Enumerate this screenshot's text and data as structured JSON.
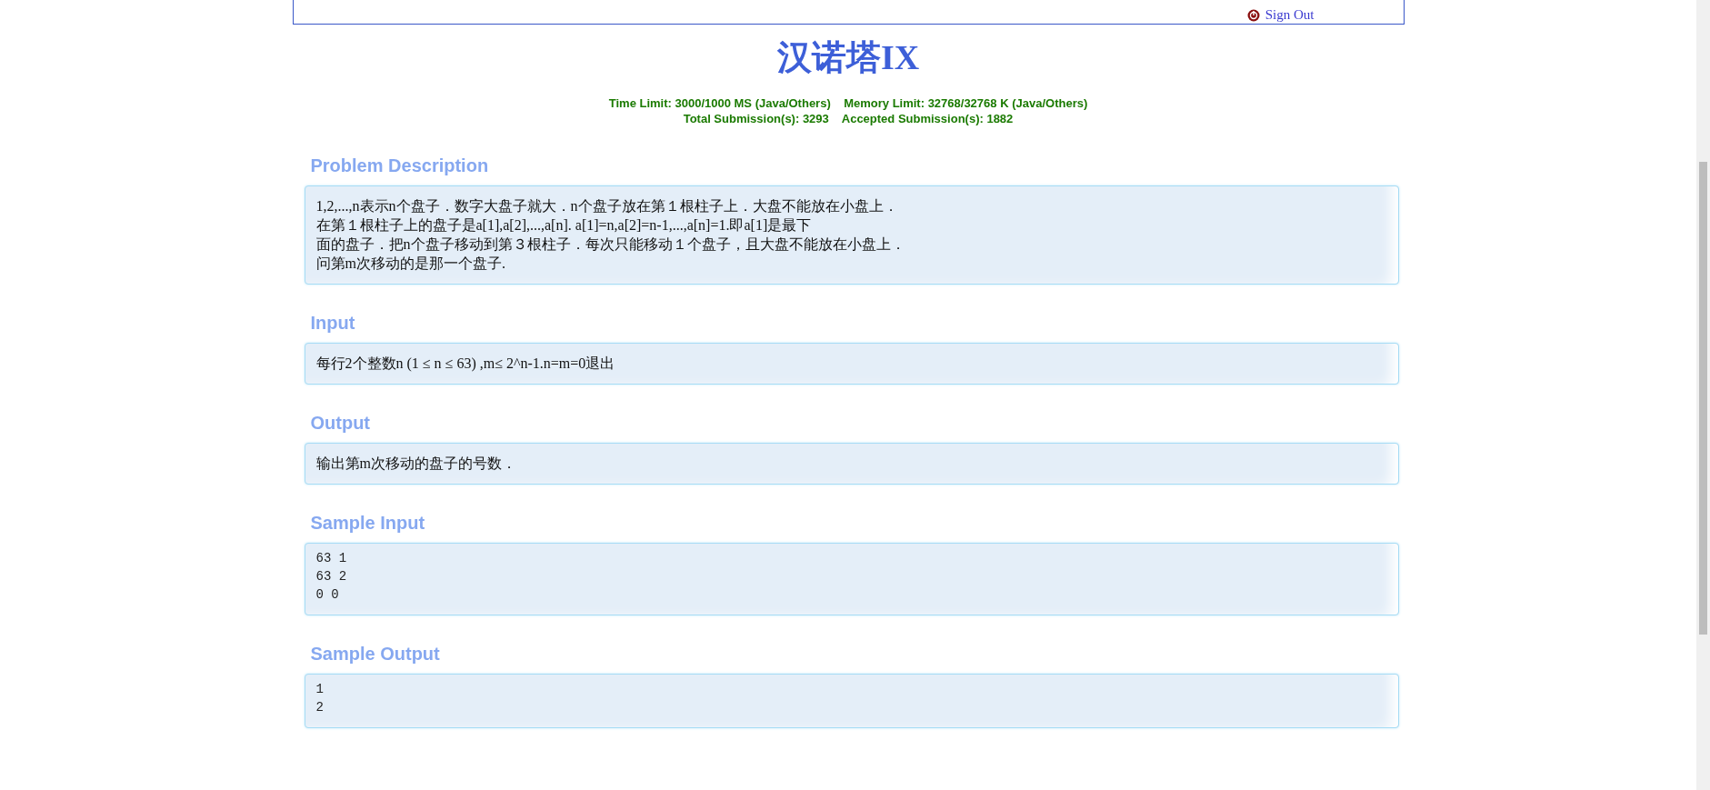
{
  "header": {
    "sign_out": "Sign Out"
  },
  "title": "汉诺塔IX",
  "limits": [
    "Time Limit: 3000/1000 MS (Java/Others)    Memory Limit: 32768/32768 K (Java/Others)",
    "Total Submission(s): 3293    Accepted Submission(s): 1882"
  ],
  "sections": [
    {
      "heading": "Problem Description",
      "kind": "text",
      "lines": [
        "1,2,...,n表示n个盘子．数字大盘子就大．n个盘子放在第１根柱子上．大盘不能放在小盘上．",
        "在第１根柱子上的盘子是a[1],a[2],...,a[n]. a[1]=n,a[2]=n-1,...,a[n]=1.即a[1]是最下",
        "面的盘子．把n个盘子移动到第３根柱子．每次只能移动１个盘子，且大盘不能放在小盘上．",
        "问第m次移动的是那一个盘子."
      ]
    },
    {
      "heading": "Input",
      "kind": "text",
      "lines": [
        "每行2个整数n (1 ≤ n ≤ 63) ,m≤ 2^n-1.n=m=0退出"
      ]
    },
    {
      "heading": "Output",
      "kind": "text",
      "lines": [
        "输出第m次移动的盘子的号数．"
      ]
    },
    {
      "heading": "Sample Input",
      "kind": "code",
      "lines": [
        "63 1",
        "63 2",
        "0 0"
      ]
    },
    {
      "heading": "Sample Output",
      "kind": "code",
      "lines": [
        "1",
        "2"
      ]
    }
  ]
}
